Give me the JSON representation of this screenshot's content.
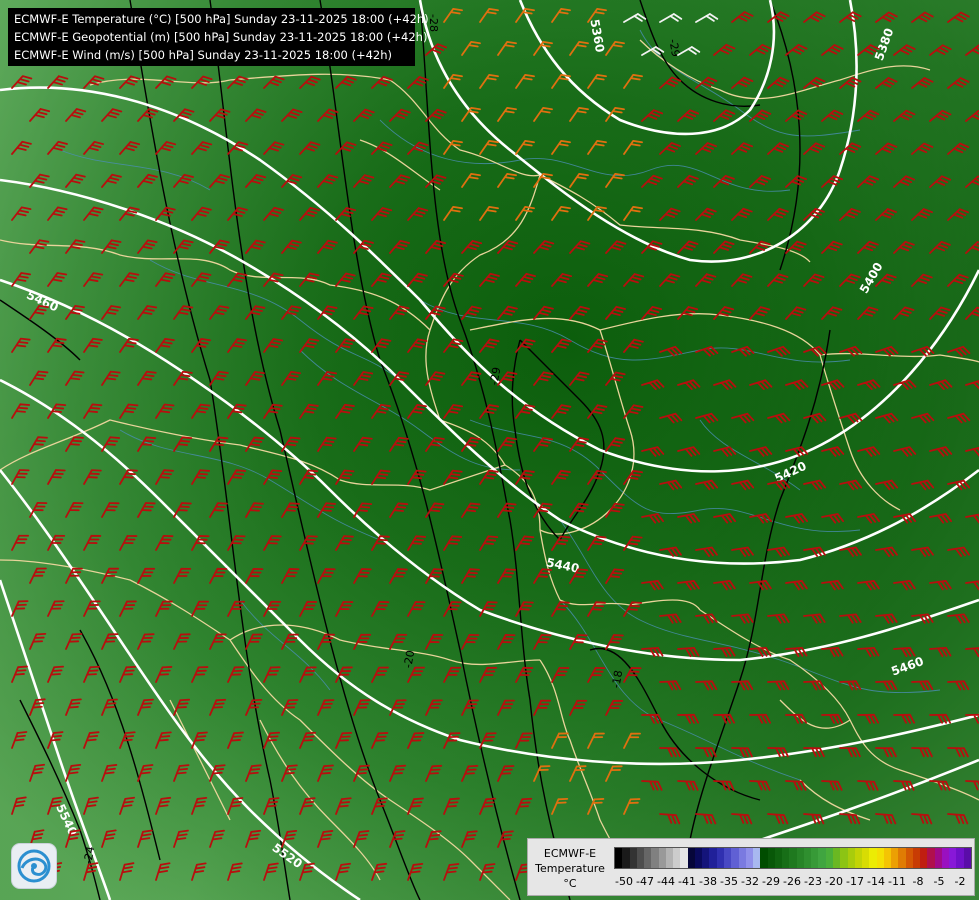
{
  "titles": {
    "line1": "ECMWF-E Temperature (°C) [500 hPa] Sunday 23-11-2025 18:00 (+42h)",
    "line2": "ECMWF-E Geopotential (m) [500 hPa] Sunday 23-11-2025 18:00 (+42h)",
    "line3": "ECMWF-E Wind (m/s) [500 hPa] Sunday 23-11-2025 18:00 (+42h)"
  },
  "legend": {
    "title1": "ECMWF-E",
    "title2": "Temperature",
    "unit": "°C",
    "ticks": [
      "-50",
      "-47",
      "-44",
      "-41",
      "-38",
      "-35",
      "-32",
      "-29",
      "-26",
      "-23",
      "-20",
      "-17",
      "-14",
      "-11",
      "-8",
      "-5",
      "-2"
    ],
    "colors": [
      "#000000",
      "#1a1a1a",
      "#333333",
      "#4d4d4d",
      "#666666",
      "#808080",
      "#999999",
      "#b3b3b3",
      "#cccccc",
      "#e6e6e6",
      "#06063a",
      "#0a0a5c",
      "#14147a",
      "#202099",
      "#3030b0",
      "#4848c4",
      "#6060d4",
      "#7a7ae0",
      "#9090ea",
      "#a8b8f0",
      "#004d00",
      "#085808",
      "#0f630f",
      "#176e17",
      "#1f791f",
      "#278427",
      "#2f8f2f",
      "#379a37",
      "#40a540",
      "#4aaf3a",
      "#6ab822",
      "#8cc414",
      "#a8cc0c",
      "#c2d406",
      "#d8dc04",
      "#ecec04",
      "#f4e004",
      "#f4c404",
      "#eca004",
      "#e07c04",
      "#d45804",
      "#c83c04",
      "#c01e10",
      "#b0104c",
      "#a00a88",
      "#9a10c0",
      "#8818d8",
      "#7010c8",
      "#5a0ca8"
    ]
  },
  "contours": {
    "geopotential": [
      "5460",
      "5360",
      "5380",
      "5400",
      "5420",
      "5440",
      "5460",
      "5540",
      "5520"
    ],
    "temperature": [
      "-28",
      "-29",
      "-29",
      "-20",
      "-18",
      "-24"
    ]
  },
  "colors": {
    "barb_red": "#b80e0e",
    "barb_orange": "#e07010",
    "barb_white": "#f2f2f2",
    "border": "#e8d49a",
    "river": "#4b8fb5",
    "contour": "#ffffff",
    "isotherm": "#000000"
  },
  "icons": {
    "logo": "ecmwf-swirl-logo-icon"
  }
}
